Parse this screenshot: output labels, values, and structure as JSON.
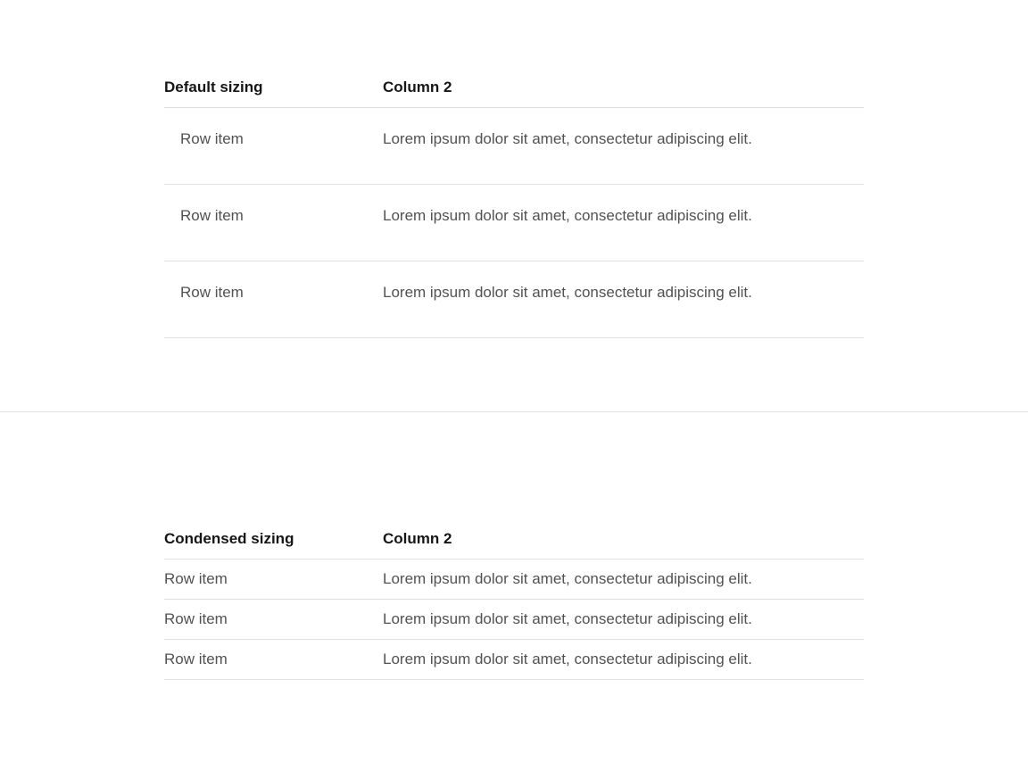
{
  "tables": {
    "default_table": {
      "headers": {
        "col1": "Default sizing",
        "col2": "Column 2"
      },
      "rows": [
        {
          "col1": "Row item",
          "col2": "Lorem ipsum dolor sit amet, consectetur adipiscing elit."
        },
        {
          "col1": "Row item",
          "col2": "Lorem ipsum dolor sit amet, consectetur adipiscing elit."
        },
        {
          "col1": "Row item",
          "col2": "Lorem ipsum dolor sit amet, consectetur adipiscing elit."
        }
      ]
    },
    "condensed_table": {
      "headers": {
        "col1": "Condensed sizing",
        "col2": "Column 2"
      },
      "rows": [
        {
          "col1": "Row item",
          "col2": "Lorem ipsum dolor sit amet, consectetur adipiscing elit."
        },
        {
          "col1": "Row item",
          "col2": "Lorem ipsum dolor sit amet, consectetur adipiscing elit."
        },
        {
          "col1": "Row item",
          "col2": "Lorem ipsum dolor sit amet, consectetur adipiscing elit."
        }
      ]
    }
  }
}
